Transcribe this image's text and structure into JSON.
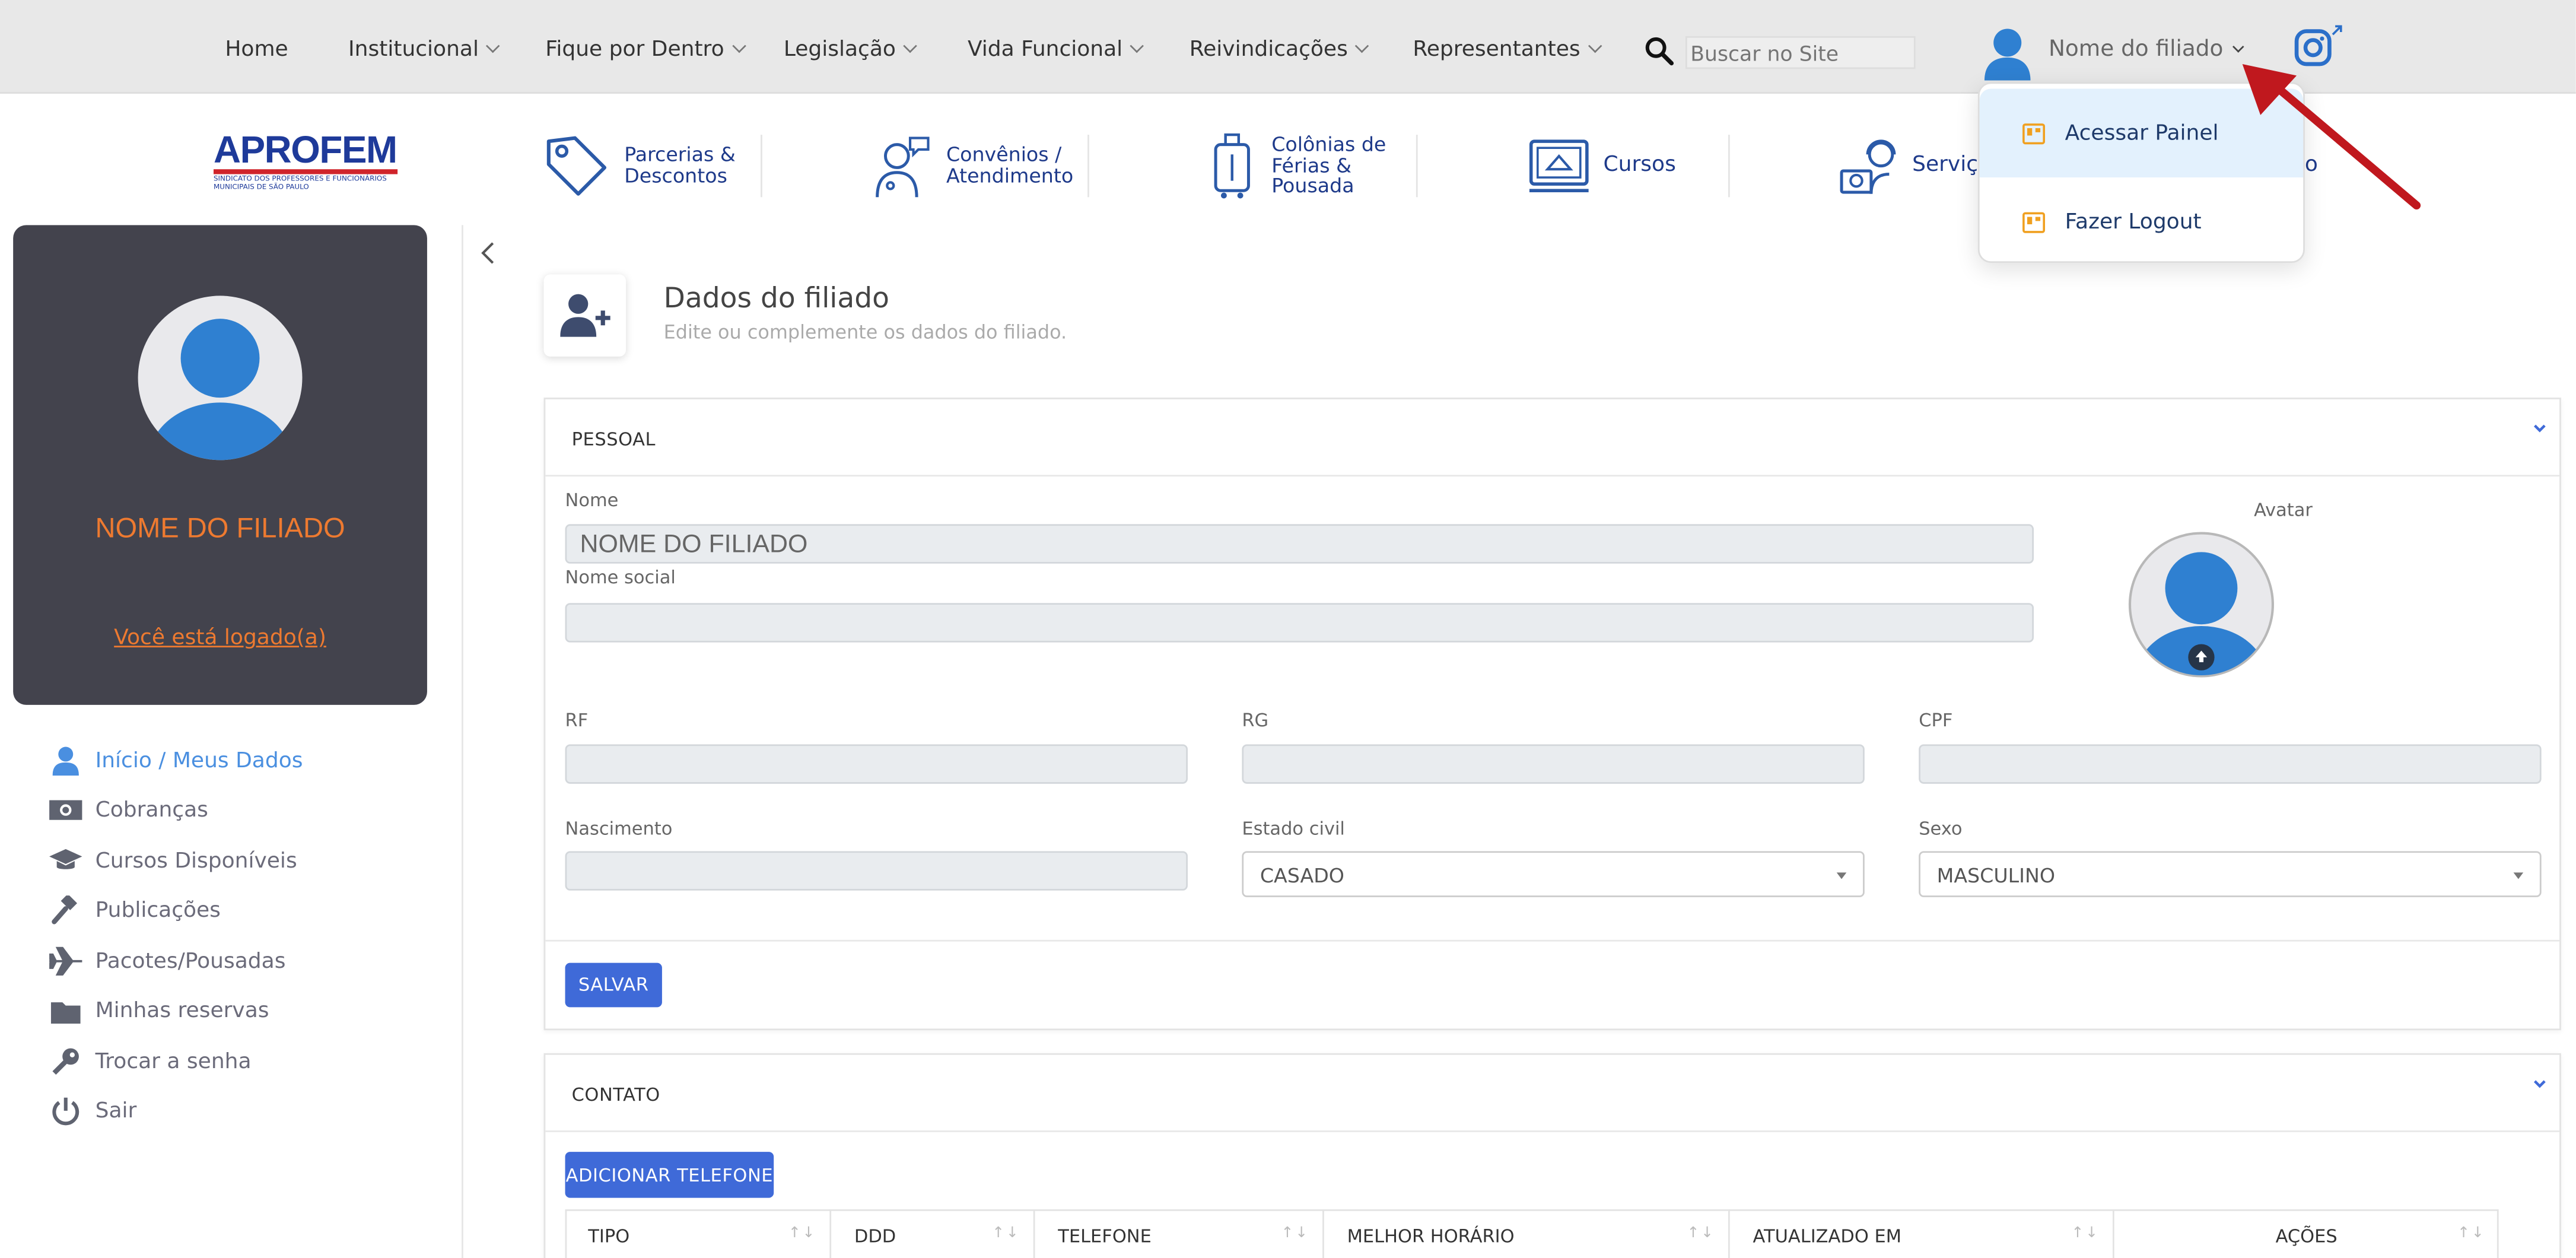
{
  "nav": {
    "items": [
      {
        "label": "Home",
        "dropdown": false
      },
      {
        "label": "Institucional",
        "dropdown": true
      },
      {
        "label": "Fique por Dentro",
        "dropdown": true
      },
      {
        "label": "Legislação",
        "dropdown": true
      },
      {
        "label": "Vida Funcional",
        "dropdown": true
      },
      {
        "label": "Reivindicações",
        "dropdown": true
      },
      {
        "label": "Representantes",
        "dropdown": true
      }
    ],
    "search_placeholder": "Buscar no Site",
    "user_name": "Nome do filiado"
  },
  "user_menu": {
    "items": [
      {
        "label": "Acessar Painel",
        "highlighted": true
      },
      {
        "label": "Fazer Logout",
        "highlighted": false
      }
    ]
  },
  "logo": {
    "name": "APROFEM",
    "tagline_1": "SINDICATO DOS PROFESSORES E FUNCIONÁRIOS",
    "tagline_2": "MUNICIPAIS DE SÃO PAULO"
  },
  "services": [
    {
      "label_1": "Parcerias &",
      "label_2": "Descontos",
      "label_3": "",
      "icon": "tag-icon"
    },
    {
      "label_1": "Convênios /",
      "label_2": "Atendimento",
      "label_3": "",
      "icon": "doctor-icon"
    },
    {
      "label_1": "Colônias de",
      "label_2": "Férias &",
      "label_3": "Pousada",
      "icon": "luggage-icon"
    },
    {
      "label_1": "Cursos",
      "label_2": "",
      "label_3": "",
      "icon": "monitor-icon"
    },
    {
      "label_1": "Serviços",
      "label_2": "",
      "label_3": "",
      "icon": "support-icon"
    },
    {
      "label_1": "o",
      "label_2": "",
      "label_3": "",
      "icon": ""
    }
  ],
  "profile": {
    "name": "NOME DO FILIADO",
    "status": "Você está logado(a)"
  },
  "sidebar": {
    "items": [
      {
        "label": "Início / Meus Dados",
        "icon": "user-icon",
        "active": true
      },
      {
        "label": "Cobranças",
        "icon": "money-icon",
        "active": false
      },
      {
        "label": "Cursos Disponíveis",
        "icon": "graduation-cap-icon",
        "active": false
      },
      {
        "label": "Publicações",
        "icon": "gavel-icon",
        "active": false
      },
      {
        "label": "Pacotes/Pousadas",
        "icon": "plane-icon",
        "active": false
      },
      {
        "label": "Minhas reservas",
        "icon": "folder-icon",
        "active": false
      },
      {
        "label": "Trocar a senha",
        "icon": "key-icon",
        "active": false
      },
      {
        "label": "Sair",
        "icon": "power-icon",
        "active": false
      }
    ]
  },
  "page": {
    "title": "Dados do filiado",
    "subtitle": "Edite ou complemente os dados do filiado."
  },
  "pessoal": {
    "header": "PESSOAL",
    "nome_label": "Nome",
    "nome_value": "NOME DO FILIADO",
    "nome_social_label": "Nome social",
    "nome_social_value": "",
    "avatar_label": "Avatar",
    "rf_label": "RF",
    "rg_label": "RG",
    "cpf_label": "CPF",
    "nascimento_label": "Nascimento",
    "estado_civil_label": "Estado civil",
    "estado_civil_value": "CASADO",
    "sexo_label": "Sexo",
    "sexo_value": "MASCULINO",
    "save_label": "SALVAR"
  },
  "contato": {
    "header": "CONTATO",
    "add_phone_label": "ADICIONAR TELEFONE",
    "columns": [
      "TIPO",
      "DDD",
      "TELEFONE",
      "MELHOR HORÁRIO",
      "ATUALIZADO EM",
      "AÇÕES"
    ]
  },
  "colors": {
    "accent_blue": "#3f6ad8",
    "orange": "#ee7a30",
    "card_dark": "#43434d",
    "avatar_blue": "#2f80d1",
    "arrow_red": "#c0181e"
  }
}
